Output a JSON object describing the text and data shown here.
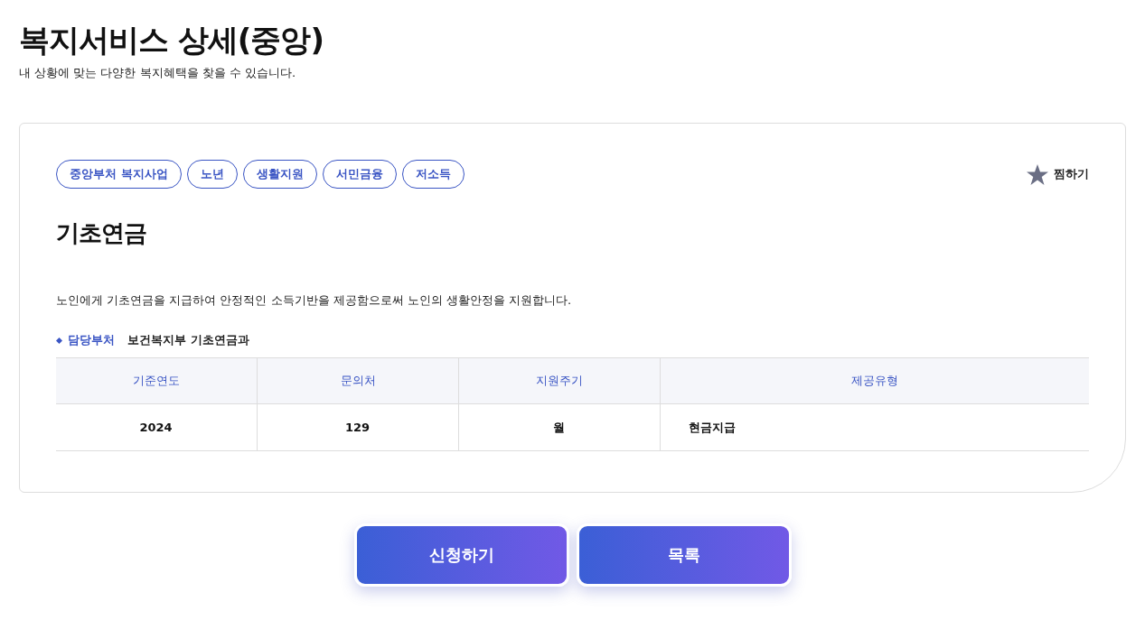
{
  "page": {
    "title": "복지서비스 상세(중앙)",
    "subtitle": "내 상황에 맞는 다양한 복지혜택을 찾을 수 있습니다."
  },
  "service": {
    "tags": [
      "중앙부처 복지사업",
      "노년",
      "생활지원",
      "서민금융",
      "저소득"
    ],
    "bookmark": "찜하기",
    "name": "기초연금",
    "description": "노인에게 기초연금을 지급하여 안정적인 소득기반을 제공함으로써 노인의 생활안정을 지원합니다.",
    "department": {
      "label": "담당부처",
      "value": "보건복지부 기초연금과"
    },
    "table": {
      "columns": [
        "기준연도",
        "문의처",
        "지원주기",
        "제공유형"
      ],
      "rows": [
        [
          "2024",
          "129",
          "월",
          "현금지급"
        ]
      ]
    }
  },
  "buttons": [
    "신청하기",
    "목록"
  ]
}
